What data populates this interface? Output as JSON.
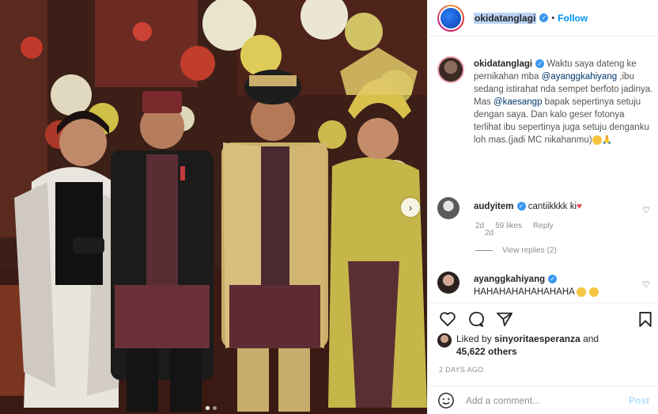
{
  "post": {
    "username": "okidatanglagi",
    "follow_label": "Follow",
    "separator": "•",
    "caption": {
      "username": "okidatanglagi",
      "part1": " Waktu saya dateng ke pernikahan mba ",
      "mention1": "@ayanggkahiyang",
      "part2": " ,ibu sedang istirahat nda sempet berfoto jadinya. Mas ",
      "mention2": "@kaesangp",
      "part3": " bapak sepertinya setuju dengan saya. Dan kalo geser fotonya terlihat ibu sepertinya juga setuju denganku loh mas.(jadi MC nikahanmu)",
      "time": "2d"
    },
    "comments": [
      {
        "username": "audyitem",
        "text": "cantiikkkk ki",
        "time": "2d",
        "likes": "59 likes",
        "reply_label": "Reply",
        "view_replies": "View replies (2)"
      },
      {
        "username": "ayanggkahiyang",
        "text": "HAHAHAHAHAHAHAHA"
      }
    ],
    "likes_prefix": "Liked by ",
    "liked_by_user": "sinyoritaesperanza",
    "likes_and": " and",
    "likes_others": "45,622 others",
    "date": "2 DAYS AGO",
    "add_comment_placeholder": "Add a comment...",
    "post_label": "Post",
    "next_arrow": "›"
  },
  "icons": {
    "like": "heart-icon",
    "comment": "comment-icon",
    "share": "paper-plane-icon",
    "save": "bookmark-icon",
    "emoji": "smiley-icon"
  },
  "colors": {
    "link": "#0095f6",
    "mention": "#00376b",
    "muted": "#8e8e8e",
    "post_button": "#b2dffc"
  }
}
